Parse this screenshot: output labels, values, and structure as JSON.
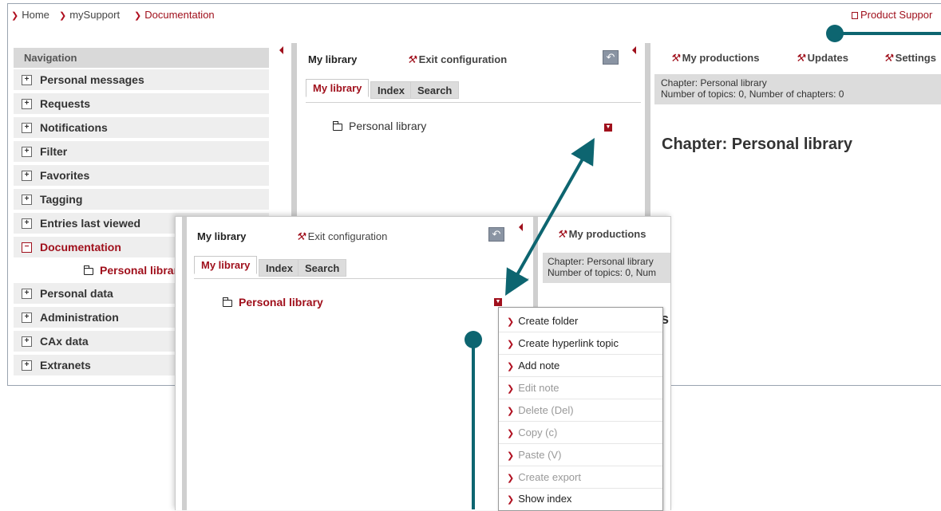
{
  "breadcrumb": [
    {
      "label": "Home"
    },
    {
      "label": "mySupport"
    },
    {
      "label": "Documentation"
    }
  ],
  "header": {
    "product_support": "Product Suppor"
  },
  "navigation": {
    "title": "Navigation",
    "items": [
      {
        "label": "Personal messages",
        "icon": "+"
      },
      {
        "label": "Requests",
        "icon": "+"
      },
      {
        "label": "Notifications",
        "icon": "+"
      },
      {
        "label": "Filter",
        "icon": "+"
      },
      {
        "label": "Favorites",
        "icon": "+"
      },
      {
        "label": "Tagging",
        "icon": "+"
      },
      {
        "label": "Entries last viewed",
        "icon": "+"
      },
      {
        "label": "Documentation",
        "icon": "−"
      },
      {
        "label": "Personal data",
        "icon": "+"
      },
      {
        "label": "Administration",
        "icon": "+"
      },
      {
        "label": "CAx data",
        "icon": "+"
      },
      {
        "label": "Extranets",
        "icon": "+"
      }
    ],
    "sub_item": "Personal library"
  },
  "library_panel": {
    "title": "My library",
    "exit_configuration": "Exit configuration",
    "reset_icon": "↶",
    "tabs": [
      "My library",
      "Index",
      "Search"
    ],
    "tree_item": "Personal library"
  },
  "right_panel": {
    "links": [
      "My productions",
      "Updates",
      "Settings"
    ],
    "info_line1": "Chapter: Personal library",
    "info_line2": "Number of topics: 0, Number of chapters: 0",
    "chapter_heading": "Chapter: Personal library"
  },
  "zoom": {
    "title": "My library",
    "exit_configuration": "Exit configuration",
    "reset_icon": "↶",
    "tabs": [
      "My library",
      "Index",
      "Search"
    ],
    "tree_item": "Personal library",
    "right_link": "My productions",
    "info_line1": "Chapter: Personal library",
    "info_line2": "Number of topics: 0, Num",
    "heading_fragment": "s"
  },
  "context_menu": {
    "items": [
      {
        "label": "Create folder",
        "enabled": true
      },
      {
        "label": "Create hyperlink topic",
        "enabled": true
      },
      {
        "label": "Add note",
        "enabled": true
      },
      {
        "label": "Edit note",
        "enabled": false
      },
      {
        "label": "Delete (Del)",
        "enabled": false
      },
      {
        "label": "Copy (c)",
        "enabled": false
      },
      {
        "label": "Paste (V)",
        "enabled": false
      },
      {
        "label": "Create export",
        "enabled": false
      },
      {
        "label": "Show index",
        "enabled": true
      }
    ]
  },
  "colors": {
    "accent": "#a0101c",
    "callout": "#0d6570",
    "nav_bg": "#eeeeee",
    "info_bg": "#dcdcdc"
  }
}
